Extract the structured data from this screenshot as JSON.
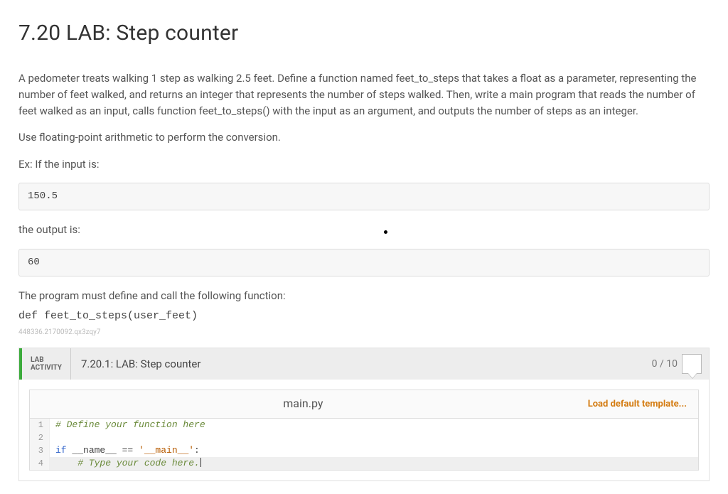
{
  "title": "7.20 LAB: Step counter",
  "paragraphs": {
    "intro": "A pedometer treats walking 1 step as walking 2.5 feet. Define a function named feet_to_steps that takes a float as a parameter, representing the number of feet walked, and returns an integer that represents the number of steps walked. Then, write a main program that reads the number of feet walked as an input, calls function feet_to_steps() with the input as an argument, and outputs the number of steps as an integer.",
    "fp": "Use floating-point arithmetic to perform the conversion.",
    "ex_prefix": "Ex: If the input is:",
    "out_prefix": "the output is:",
    "mustdef": "The program must define and call the following function:"
  },
  "example_input": "150.5",
  "example_output": "60",
  "fn_sig": "def feet_to_steps(user_feet)",
  "fine_print": "448336.2170092.qx3zqy7",
  "lab": {
    "label_top": "LAB",
    "label_bot": "ACTIVITY",
    "title": "7.20.1: LAB: Step counter",
    "score": "0 / 10"
  },
  "editor": {
    "filename": "main.py",
    "action": "Load default template...",
    "lines": [
      {
        "n": "1",
        "comment": "# Define your function here",
        "hl": false
      },
      {
        "n": "2",
        "plain": "",
        "hl": false
      },
      {
        "n": "3",
        "kw": "if",
        "mid": " __name__ == ",
        "str": "'__main__'",
        "tail": ":",
        "hl": false
      },
      {
        "n": "4",
        "comment": "    # Type your code here.",
        "cursor": true,
        "hl": true
      }
    ]
  }
}
